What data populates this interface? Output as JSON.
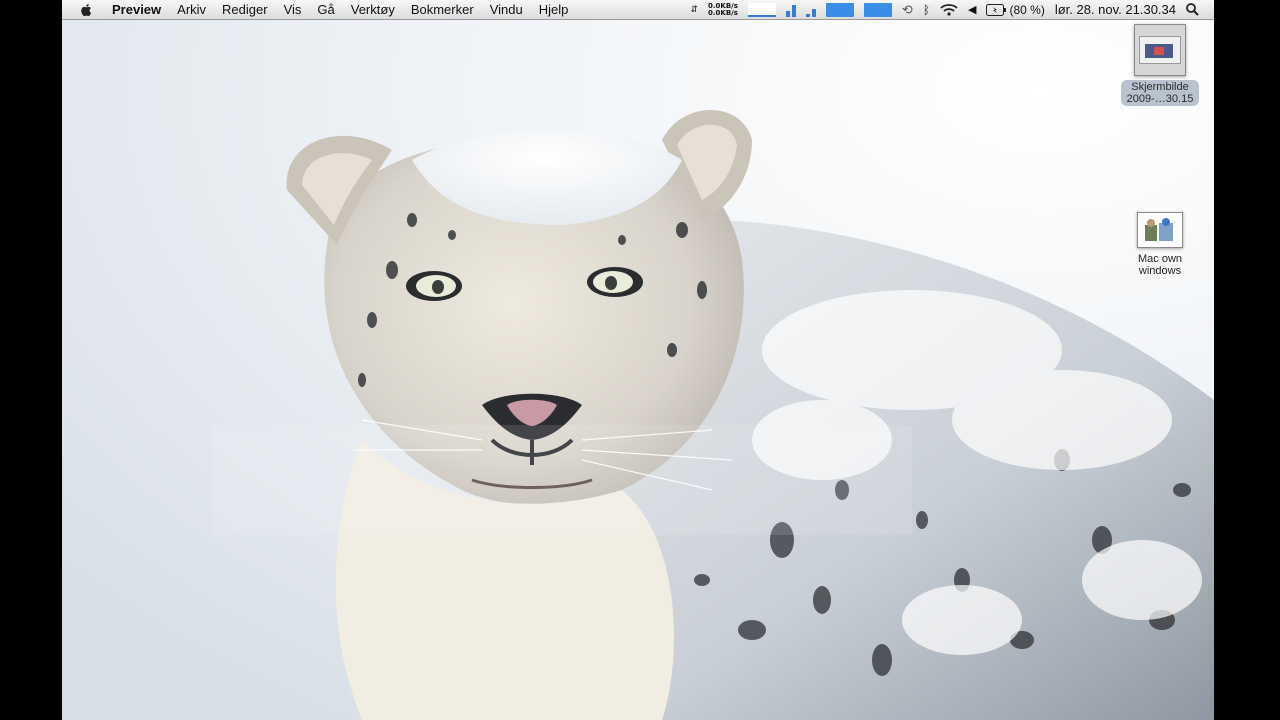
{
  "menubar": {
    "apple_icon": "apple-logo-icon",
    "items": [
      "Preview",
      "Arkiv",
      "Rediger",
      "Vis",
      "Gå",
      "Verktøy",
      "Bokmerker",
      "Vindu",
      "Hjelp"
    ]
  },
  "status": {
    "net_up": "0.0KB/s",
    "net_down": "0.0KB/s",
    "battery_percent": "(80 %)",
    "clock": "lør. 28. nov.  21.30.34",
    "icons": [
      "updown-arrows-icon",
      "network-graph-icon",
      "memory-icon",
      "cpu-icon",
      "disk-icon",
      "timemachine-icon",
      "bluetooth-icon",
      "wifi-icon",
      "volume-icon",
      "battery-icon",
      "spotlight-icon"
    ]
  },
  "desktop": {
    "icons": [
      {
        "label_line1": "Skjermbilde",
        "label_line2": "2009-…30.15"
      },
      {
        "label_line1": "Mac own",
        "label_line2": "windows"
      }
    ]
  },
  "colors": {
    "menubar_top": "#f7f7f7",
    "menubar_bottom": "#dcdcdc",
    "accent_blue": "#3b8ee8",
    "snow": "#eef2f6"
  }
}
